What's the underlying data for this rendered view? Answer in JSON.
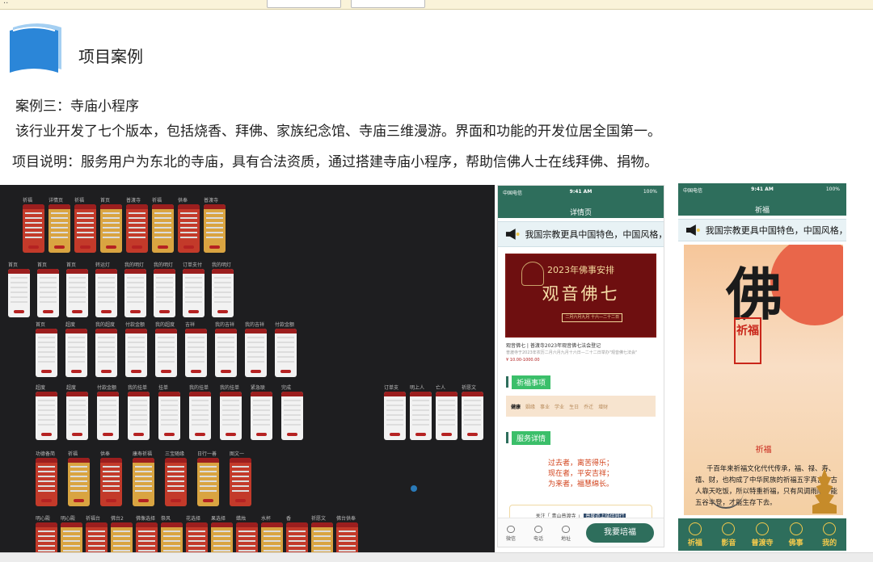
{
  "header": {
    "section_title": "项目案例",
    "case_line": "案例三：寺庙小程序",
    "desc_line": "该行业开发了七个版本，包括烧香、拜佛、家族纪念馆、寺庙三维漫游。界面和功能的开发位居全国第一。",
    "project_note": "项目说明：服务用户为东北的寺庙，具有合法资质，通过搭建寺庙小程序，帮助信佛人士在线拜佛、捐物。"
  },
  "board": {
    "rows": [
      {
        "labels": [
          "祈福",
          "详情页",
          "祈福",
          "首页",
          "普渡寺",
          "祈福",
          "供奉",
          "普渡寺"
        ]
      },
      {
        "labels": [
          "首页",
          "首页",
          "首页",
          "转运灯",
          "我的明灯",
          "我的明灯",
          "订单支付",
          "我的明灯"
        ]
      },
      {
        "labels": [
          "首页",
          "超度",
          "我的超度",
          "付款金额",
          "我的超度",
          "吉祥",
          "我的吉祥",
          "我的吉祥",
          "付款金额"
        ]
      },
      {
        "labels": [
          "超度",
          "超度",
          "付款金额",
          "我的挂单",
          "挂单",
          "我的挂单",
          "我的挂单",
          "紧急联",
          "完成",
          "订单支",
          "明上人",
          "亡人",
          "祈愿文"
        ]
      },
      {
        "labels": [
          "功德备简",
          "祈福",
          "供奉",
          "康寿祈福",
          "三宝随缘",
          "日行一善",
          "图文一"
        ]
      },
      {
        "labels": [
          "明心殿",
          "明心殿",
          "祈福台",
          "佛台2",
          "佛像选择",
          "祭风",
          "花选择",
          "果选择",
          "蜡烛",
          "水杯",
          "香",
          "祈愿文",
          "佛台供奉"
        ]
      }
    ]
  },
  "phone1": {
    "carrier": "中国电信",
    "time": "9:41 AM",
    "battery": "100%",
    "title": "详情页",
    "marquee": "我国宗教更具中国特色，中国风格，",
    "poster_year": "2023年佛事安排",
    "poster_main": "观音佛七",
    "poster_date": "二月六月九月 十六—二十二日",
    "event_title": "观音佛七 | 普渡寺2023年观音佛七法会登记",
    "event_sub": "普渡寺于2023年农历二月六月九月十六日—二十二日举办\"观音佛七法会\"",
    "event_price": "¥ 10.00-1000.00",
    "section_items": "祈福事项",
    "tabs": [
      "健康",
      "姻缘",
      "事业",
      "学业",
      "生日",
      "乔迁",
      "增财"
    ],
    "section_service": "服务详情",
    "verse": [
      "过去者，离苦得乐；",
      "现在者，平安吉祥；",
      "为来者，福慧绵长。"
    ],
    "follow_text": "关注「 青山普渡寺 」",
    "follow_hl": "普度道上结伴同行",
    "nav": [
      "微信",
      "电话",
      "地址"
    ],
    "cta": "我要培福"
  },
  "phone2": {
    "carrier": "中国电信",
    "time": "9:41 AM",
    "battery": "100%",
    "title": "祈福",
    "marquee": "我国宗教更具中国特色，中国风格，",
    "big_char": "佛",
    "stamp": "祈福",
    "sub": "祈福",
    "paragraph": "千百年来祈福文化代代传承，福、禄、寿、禧、财，也构成了中华民族的祈福五字真言。古人靠天吃饭，所以特重祈福，只有风调雨顺才能五谷丰登，才能生存下去。",
    "nav": [
      "祈福",
      "影音",
      "普渡寺",
      "佛事",
      "我的"
    ]
  }
}
